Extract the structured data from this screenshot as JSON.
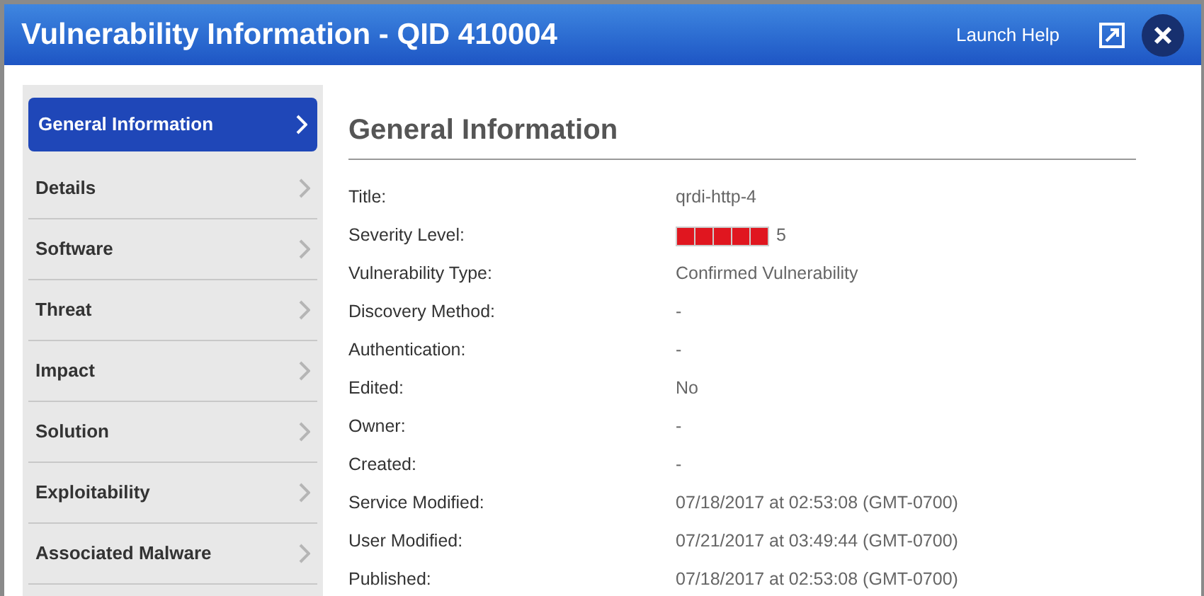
{
  "window": {
    "title": "Vulnerability Information - QID 410004",
    "help": "Launch Help"
  },
  "sidebar": {
    "items": [
      {
        "label": "General Information",
        "selected": true
      },
      {
        "label": "Details",
        "selected": false
      },
      {
        "label": "Software",
        "selected": false
      },
      {
        "label": "Threat",
        "selected": false
      },
      {
        "label": "Impact",
        "selected": false
      },
      {
        "label": "Solution",
        "selected": false
      },
      {
        "label": "Exploitability",
        "selected": false
      },
      {
        "label": "Associated Malware",
        "selected": false
      }
    ]
  },
  "section": {
    "heading": "General Information"
  },
  "fields": [
    {
      "kind": "text",
      "label": "Title:",
      "value": "qrdi-http-4"
    },
    {
      "kind": "severity",
      "label": "Severity Level:",
      "stars": 5,
      "value": "5"
    },
    {
      "kind": "text",
      "label": "Vulnerability Type:",
      "value": "Confirmed Vulnerability"
    },
    {
      "kind": "text",
      "label": "Discovery Method:",
      "value": "-"
    },
    {
      "kind": "text",
      "label": "Authentication:",
      "value": "-"
    },
    {
      "kind": "text",
      "label": "Edited:",
      "value": "No"
    },
    {
      "kind": "text",
      "label": "Owner:",
      "value": "-"
    },
    {
      "kind": "text",
      "label": "Created:",
      "value": "-"
    },
    {
      "kind": "text",
      "label": "Service Modified:",
      "value": "07/18/2017 at 02:53:08 (GMT-0700)"
    },
    {
      "kind": "text",
      "label": "User Modified:",
      "value": "07/21/2017 at 03:49:44 (GMT-0700)"
    },
    {
      "kind": "text",
      "label": "Published:",
      "value": "07/18/2017 at 02:53:08 (GMT-0700)"
    }
  ]
}
